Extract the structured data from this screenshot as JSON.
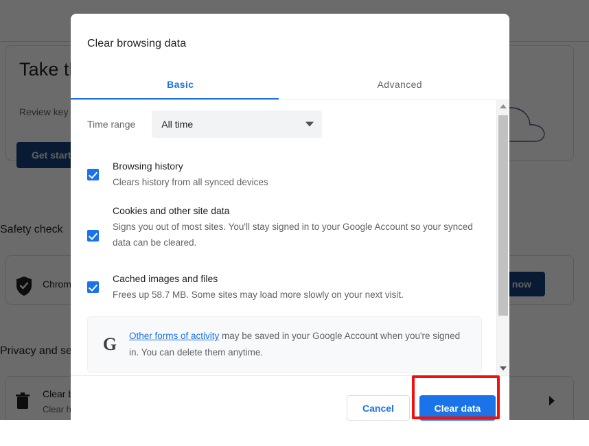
{
  "background": {
    "promo": {
      "title": "Take the Safety check",
      "subtitle": "Review key Chrome security and privacy settings",
      "button_label": "Get started"
    },
    "safety_check": {
      "heading": "Safety check",
      "row_label": "Chrome can help keep you safe from data breaches, bad extensions, and more",
      "button_label": "Check now",
      "icon": "shield-check-icon"
    },
    "privacy": {
      "heading": "Privacy and security",
      "row_title": "Clear browsing data",
      "row_subtitle": "Clear history, cookies, cache, and more",
      "icon": "trash-icon",
      "arrow_icon": "chevron-right-icon"
    }
  },
  "dialog": {
    "title": "Clear browsing data",
    "tabs": [
      {
        "label": "Basic",
        "active": true
      },
      {
        "label": "Advanced",
        "active": false
      }
    ],
    "time_range": {
      "label": "Time range",
      "value": "All time",
      "caret_icon": "chevron-down-icon"
    },
    "options": [
      {
        "title": "Browsing history",
        "description": "Clears history from all synced devices",
        "checked": true
      },
      {
        "title": "Cookies and other site data",
        "description": "Signs you out of most sites. You'll stay signed in to your Google Account so your synced data can be cleared.",
        "checked": true
      },
      {
        "title": "Cached images and files",
        "description": "Frees up 58.7 MB. Some sites may load more slowly on your next visit.",
        "checked": true
      }
    ],
    "info_box": {
      "icon": "google-g-icon",
      "link_text": "Other forms of activity",
      "text_after_link": " may be saved in your Google Account when you're signed in. You can delete them anytime."
    },
    "scrollbar": {
      "up_icon": "scroll-up-arrow-icon",
      "down_icon": "scroll-down-arrow-icon"
    },
    "footer": {
      "cancel_label": "Cancel",
      "confirm_label": "Clear data"
    }
  },
  "colors": {
    "accent_blue": "#1a73e8",
    "highlight_red": "#ee1111",
    "text_primary": "#202124",
    "text_secondary": "#5f6368"
  }
}
